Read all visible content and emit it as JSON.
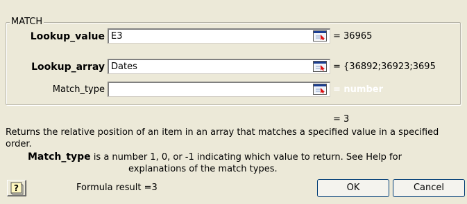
{
  "group": {
    "title": "MATCH"
  },
  "args": [
    {
      "label": "Lookup_value",
      "value": "E3",
      "result": "= 36965"
    },
    {
      "label": "Lookup_array",
      "value": "Dates",
      "result": "= {36892;36923;3695"
    },
    {
      "label": "Match_type",
      "value": "",
      "result": "= number"
    }
  ],
  "function_result": "= 3",
  "description": "Returns the relative position of an item in an array that matches a specified value in a specified order.",
  "arg_help": {
    "name": "Match_type",
    "text_line1": "is a number 1, 0, or -1 indicating which value to return. See Help for",
    "text_line2": "explanations of the match types."
  },
  "footer": {
    "formula_result": "Formula result =3",
    "ok_label": "OK",
    "cancel_label": "Cancel"
  },
  "icons": {
    "collapse": "collapse-dialog-icon",
    "help": "help-icon"
  }
}
